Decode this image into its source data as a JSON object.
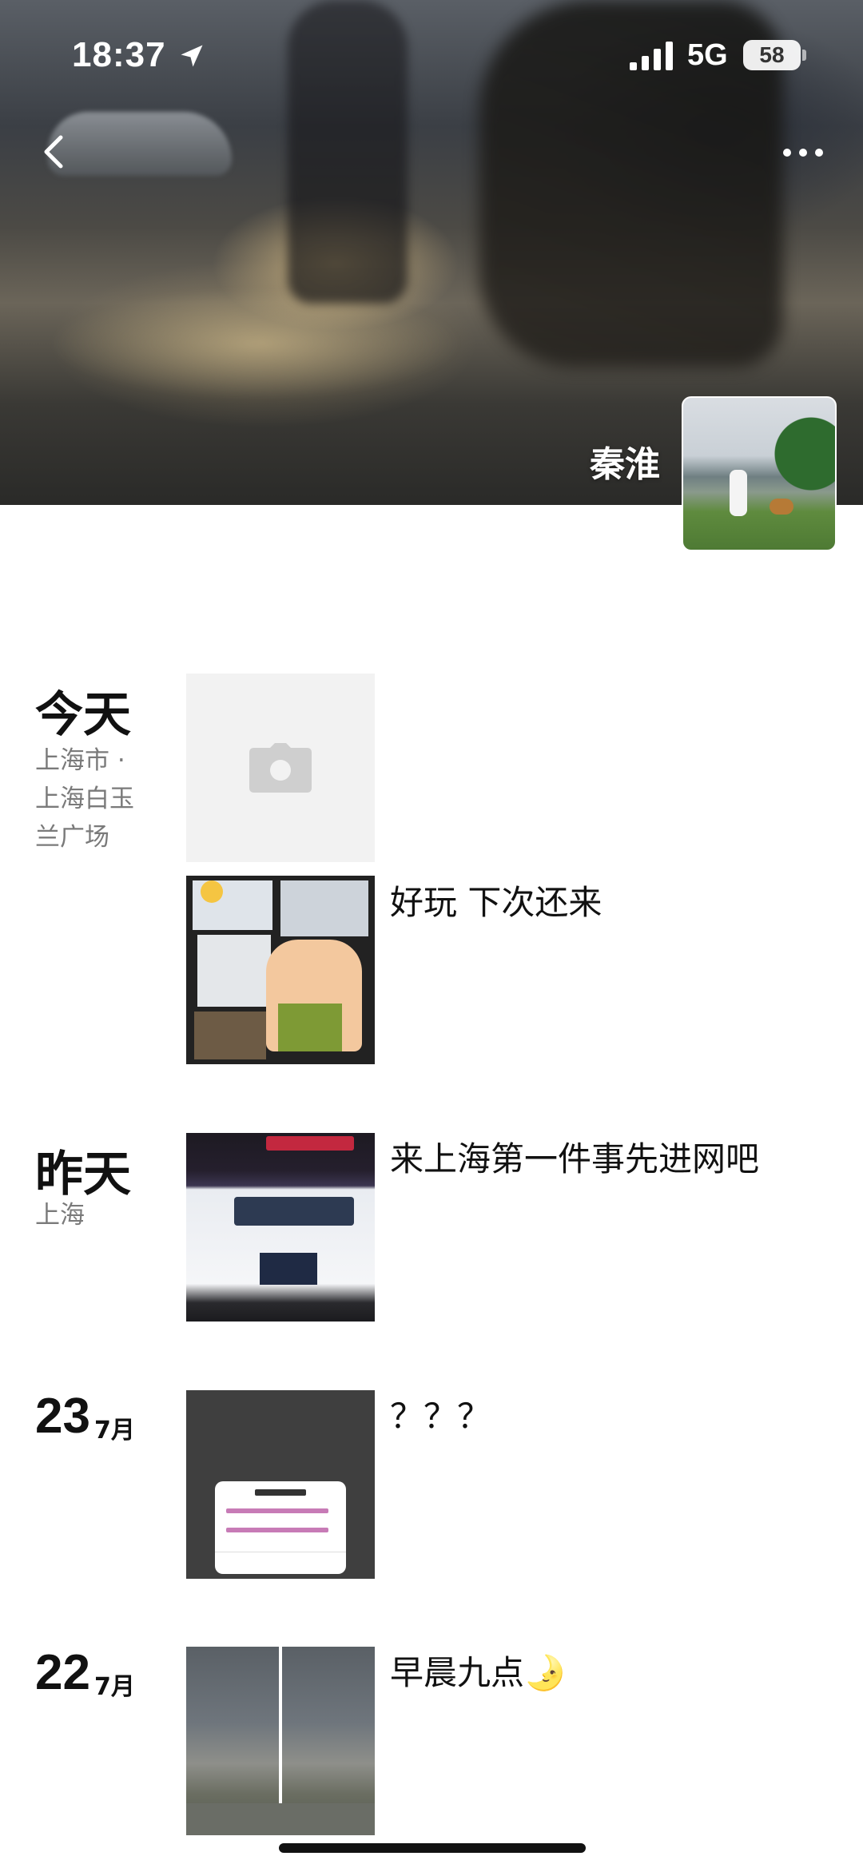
{
  "status_bar": {
    "time": "18:37",
    "network": "5G",
    "battery": "58"
  },
  "profile": {
    "name": "秦淮"
  },
  "feed": [
    {
      "date": "今天",
      "location": "上海市 · 上海白玉兰广场",
      "posts": [
        {
          "thumbnail": "camera-placeholder",
          "caption": ""
        },
        {
          "thumbnail": "photo-collage",
          "caption": "好玩 下次还来"
        }
      ]
    },
    {
      "date": "昨天",
      "location": "上海",
      "posts": [
        {
          "thumbnail": "internet-cafe-photo",
          "caption": "来上海第一件事先进网吧"
        }
      ]
    },
    {
      "day": "23",
      "month": "7月",
      "posts": [
        {
          "thumbnail": "flight-confirm-screenshot",
          "caption": "？？？"
        }
      ]
    },
    {
      "day": "22",
      "month": "7月",
      "posts": [
        {
          "thumbnail": "cloudy-sky-photos",
          "caption": "早晨九点🌛"
        }
      ]
    }
  ],
  "colors": {
    "text_primary": "#111111",
    "text_secondary": "#7a7a7a",
    "placeholder_bg": "#f2f2f2",
    "icon_white": "#ffffff"
  },
  "icons": {
    "back": "chevron-left-icon",
    "more": "more-dots-icon",
    "camera": "camera-icon",
    "location_arrow": "location-arrow-icon",
    "signal": "cellular-signal-icon",
    "battery": "battery-icon"
  }
}
